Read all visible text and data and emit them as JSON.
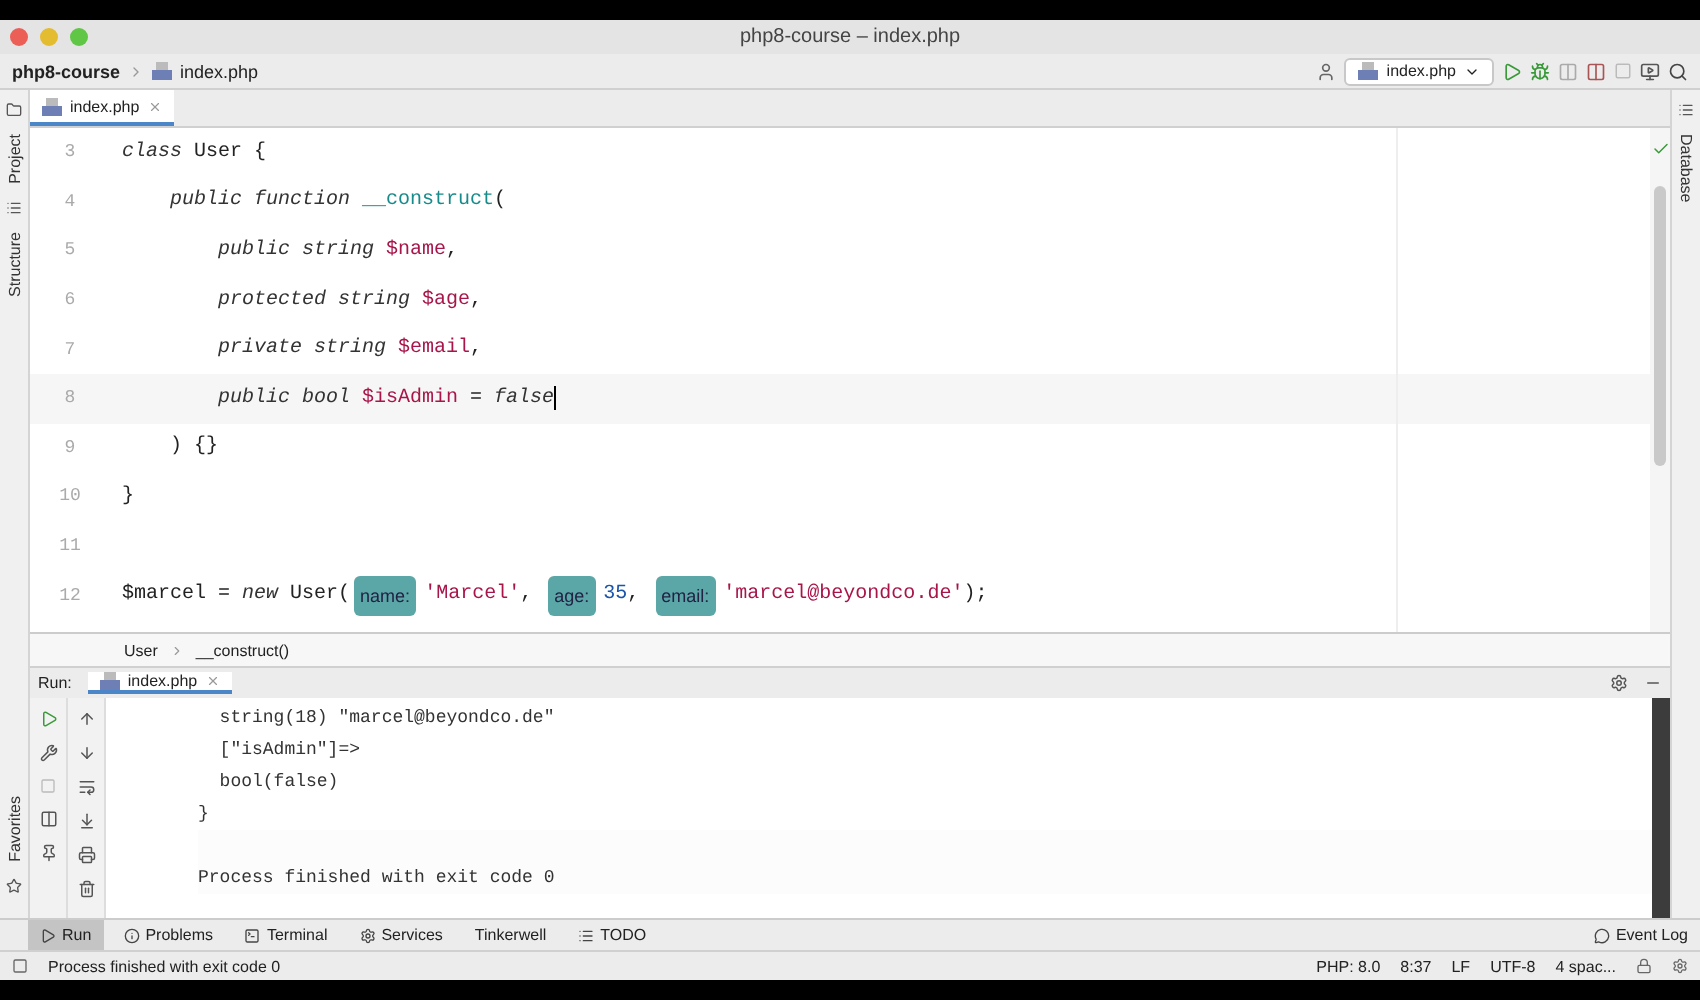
{
  "window": {
    "title": "php8-course – index.php"
  },
  "navbar": {
    "project": "php8-course",
    "file": "index.php",
    "run_config": "index.php"
  },
  "side_left": [
    {
      "label": "Project"
    },
    {
      "label": "Structure"
    }
  ],
  "side_left_bottom": {
    "label": "Favorites"
  },
  "side_right": {
    "label": "Database"
  },
  "editor_tabs": [
    {
      "label": "index.php",
      "selected": true
    }
  ],
  "code_lines": [
    {
      "number": "3",
      "current": false,
      "tokens": [
        {
          "kind": "keyword",
          "text": "class"
        },
        {
          "kind": "plain",
          "text": " User {"
        }
      ],
      "children": [
        {
          "number": "4",
          "current": false,
          "tokens": [
            {
              "kind": "keyword",
              "text": "public function"
            },
            {
              "kind": "func",
              "text": " __construct"
            },
            {
              "kind": "plain",
              "text": "("
            }
          ],
          "children": [
            {
              "number": "5",
              "current": false,
              "tokens": [
                {
                  "kind": "keyword",
                  "text": "public string"
                },
                {
                  "kind": "var",
                  "text": " $name"
                },
                {
                  "kind": "plain",
                  "text": ","
                }
              ]
            },
            {
              "number": "6",
              "current": false,
              "tokens": [
                {
                  "kind": "keyword",
                  "text": "protected string"
                },
                {
                  "kind": "var",
                  "text": " $age"
                },
                {
                  "kind": "plain",
                  "text": ","
                }
              ]
            },
            {
              "number": "7",
              "current": false,
              "tokens": [
                {
                  "kind": "keyword",
                  "text": "private string"
                },
                {
                  "kind": "var",
                  "text": " $email"
                },
                {
                  "kind": "plain",
                  "text": ","
                }
              ]
            },
            {
              "number": "8",
              "current": true,
              "tokens": [
                {
                  "kind": "keyword",
                  "text": "public bool"
                },
                {
                  "kind": "var",
                  "text": " $isAdmin"
                },
                {
                  "kind": "plain",
                  "text": " = "
                },
                {
                  "kind": "keyword",
                  "text": "false"
                }
              ]
            }
          ]
        },
        {
          "number": "9",
          "current": false,
          "tokens": [
            {
              "kind": "plain",
              "text": ") {}"
            }
          ]
        }
      ]
    },
    {
      "number": "10",
      "current": false,
      "tokens": [
        {
          "kind": "plain",
          "text": "}"
        }
      ]
    },
    {
      "number": "11",
      "current": false
    },
    {
      "number": "12",
      "current": false,
      "tokens": [
        {
          "kind": "plain",
          "text": "$marcel = "
        },
        {
          "kind": "keyword",
          "text": "new"
        },
        {
          "kind": "plain",
          "text": " User("
        },
        {
          "kind": "hint",
          "text": "name:"
        },
        {
          "kind": "string",
          "text": "'Marcel'"
        },
        {
          "kind": "plain",
          "text": ", "
        },
        {
          "kind": "hint",
          "text": "age:"
        },
        {
          "kind": "number",
          "text": "35"
        },
        {
          "kind": "plain",
          "text": ", "
        },
        {
          "kind": "hint",
          "text": "email:"
        },
        {
          "kind": "string",
          "text": "'marcel@beyondco.de'"
        },
        {
          "kind": "plain",
          "text": ");"
        }
      ]
    }
  ],
  "breadcrumb": [
    "User",
    "__construct()"
  ],
  "run_panel": {
    "label": "Run:",
    "tabs": [
      {
        "label": "index.php",
        "selected": true
      }
    ],
    "output": [
      {
        "text": "  string(18) \"marcel@beyondco.de\"",
        "blank_before": false
      },
      {
        "text": "  [\"isAdmin\"]=>",
        "blank_before": false
      },
      {
        "text": "  bool(false)",
        "blank_before": false
      },
      {
        "text": "}",
        "blank_before": false
      },
      {
        "text": "Process finished with exit code 0",
        "blank_before": true
      }
    ]
  },
  "tool_tabs": [
    {
      "label": "Run",
      "selected": true
    },
    {
      "label": "Problems",
      "selected": false
    },
    {
      "label": "Terminal",
      "selected": false
    },
    {
      "label": "Services",
      "selected": false
    },
    {
      "label": "Tinkerwell",
      "selected": false
    },
    {
      "label": "TODO",
      "selected": false
    }
  ],
  "event_log": "Event Log",
  "status_bar": {
    "message": "Process finished with exit code 0",
    "items": [
      "PHP: 8.0",
      "8:37",
      "LF",
      "UTF-8",
      "4 spac..."
    ]
  }
}
